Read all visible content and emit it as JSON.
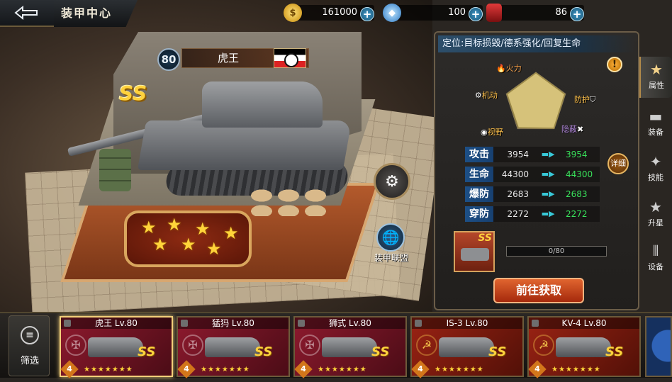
{
  "header": {
    "title": "装甲中心",
    "back_icon": "back-arrow-icon",
    "resources": [
      {
        "name": "gold",
        "icon": "gold-coin-icon",
        "value": "161000",
        "color": "#e8b21c"
      },
      {
        "name": "diamond",
        "icon": "diamond-icon",
        "value": "100",
        "color": "#5fb4ff"
      },
      {
        "name": "fuel",
        "icon": "fuel-barrel-icon",
        "value": "86",
        "color": "#c8242a"
      }
    ]
  },
  "tank": {
    "level": "80",
    "name": "虎王",
    "rank": "SS",
    "stars": 7,
    "alliance_label": "装甲联盟"
  },
  "panel": {
    "role_text": "定位:目标损毁/德系强化/回复生命",
    "axes": [
      "火力",
      "防护",
      "隐蔽",
      "视野",
      "机动"
    ],
    "axis_values": [
      0.98,
      0.97,
      0.98,
      0.96,
      0.97
    ],
    "stats": [
      {
        "name": "攻击",
        "base": "3954",
        "new": "3954"
      },
      {
        "name": "生命",
        "base": "44300",
        "new": "44300"
      },
      {
        "name": "爆防",
        "base": "2683",
        "new": "2683"
      },
      {
        "name": "穿防",
        "base": "2272",
        "new": "2272"
      }
    ],
    "detail_button": "详细",
    "item_rank": "SS",
    "progress_text": "0/80",
    "progress_fraction": 0,
    "goto_button": "前往获取"
  },
  "tabs": [
    {
      "label": "属性",
      "icon": "star-tab-icon",
      "active": true
    },
    {
      "label": "装备",
      "icon": "tank-tab-icon",
      "active": false
    },
    {
      "label": "技能",
      "icon": "tank-skill-icon",
      "active": false
    },
    {
      "label": "升星",
      "icon": "star-up-icon",
      "active": false
    },
    {
      "label": "设备",
      "icon": "shells-icon",
      "active": false
    }
  ],
  "bottom": {
    "filter_label": "筛选",
    "cards": [
      {
        "name": "虎王 Lv.80",
        "rank": "SS",
        "count": "4",
        "stars": "★★★★★★★",
        "nation": "germany",
        "selected": true
      },
      {
        "name": "猛犸 Lv.80",
        "rank": "SS",
        "count": "4",
        "stars": "★★★★★★★",
        "nation": "germany",
        "selected": false
      },
      {
        "name": "狮式 Lv.80",
        "rank": "SS",
        "count": "4",
        "stars": "★★★★★★★",
        "nation": "germany",
        "selected": false
      },
      {
        "name": "IS-3 Lv.80",
        "rank": "SS",
        "count": "4",
        "stars": "★★★★★★★",
        "nation": "ussr",
        "selected": false
      },
      {
        "name": "KV-4 Lv.80",
        "rank": "SS",
        "count": "4",
        "stars": "★★★★★★★",
        "nation": "ussr",
        "selected": false
      }
    ]
  }
}
